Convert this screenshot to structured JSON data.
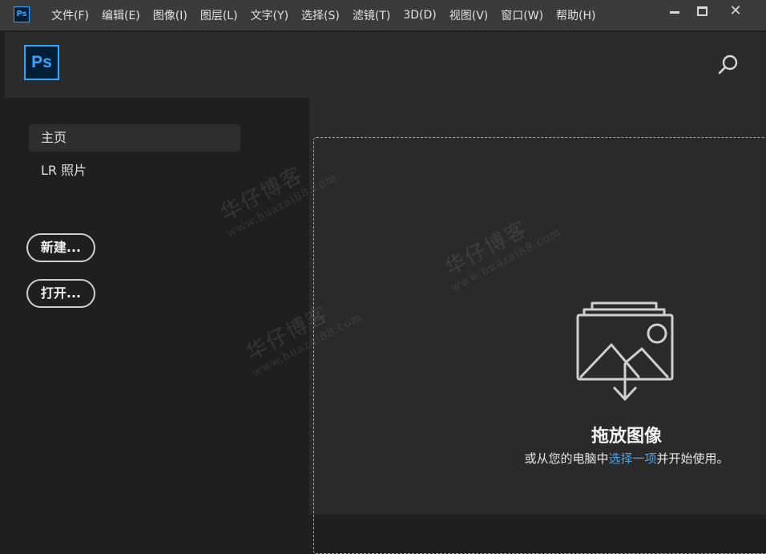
{
  "app": {
    "icon_label": "Ps"
  },
  "menu": {
    "items": [
      {
        "label": "文件(F)"
      },
      {
        "label": "编辑(E)"
      },
      {
        "label": "图像(I)"
      },
      {
        "label": "图层(L)"
      },
      {
        "label": "文字(Y)"
      },
      {
        "label": "选择(S)"
      },
      {
        "label": "滤镜(T)"
      },
      {
        "label": "3D(D)"
      },
      {
        "label": "视图(V)"
      },
      {
        "label": "窗口(W)"
      },
      {
        "label": "帮助(H)"
      }
    ]
  },
  "window_controls": {
    "close_glyph": "✕"
  },
  "header": {
    "logo_text": "Ps",
    "search_icon": "search-icon"
  },
  "sidebar": {
    "nav": [
      {
        "label": "主页",
        "selected": true
      },
      {
        "label": "LR 照片",
        "selected": false
      }
    ],
    "buttons": {
      "new_label": "新建...",
      "open_label": "打开..."
    }
  },
  "drop_area": {
    "title": "拖放图像",
    "subtitle_before": "或从您的电脑中",
    "subtitle_link": "选择一项",
    "subtitle_after": "并开始使用。",
    "icon": "image-stack-download-icon"
  },
  "watermark": {
    "text": "华仔博客",
    "url": "www.huazai88.com"
  },
  "colors": {
    "accent": "#31a8ff",
    "link": "#4aa3ef",
    "menubar": "#3b3b3b",
    "header": "#2b2b2b",
    "sidebar": "#1f1f1f",
    "main": "#2a2a2a"
  }
}
